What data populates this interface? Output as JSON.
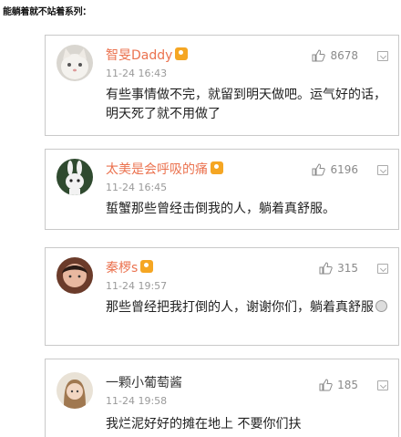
{
  "caption": "能躺着就不站着系列：",
  "comments": [
    {
      "username": "智旻Daddy",
      "time": "11-24 16:43",
      "likes": "8678",
      "text": "有些事情做不完，就留到明天做吧。运气好的话，明天死了就不用做了",
      "avatar": "cat-avatar",
      "badge": "vip-badge-icon"
    },
    {
      "username": "太美是会呼吸的痛",
      "time": "11-24 16:45",
      "likes": "6196",
      "text": "蜇蟹那些曾经击倒我的人，躺着真舒服。",
      "avatar": "rabbit-avatar",
      "badge": "vip-badge-icon"
    },
    {
      "username": "秦椤s",
      "time": "11-24 19:57",
      "likes": "315",
      "text": "那些曾经把我打倒的人，谢谢你们，躺着真舒服",
      "avatar": "person-avatar",
      "badge": "vip-badge-icon",
      "trailing_icon": "emoji-icon"
    },
    {
      "username": "一颗小葡萄酱",
      "time": "11-24 19:58",
      "likes": "185",
      "text": "我烂泥好好的摊在地上 不要你们扶",
      "avatar": "girl-avatar"
    }
  ],
  "colors": {
    "username": "#eb7350",
    "time": "#9a9a9a",
    "border": "#c9c9c9",
    "badge": "#f5a623"
  }
}
